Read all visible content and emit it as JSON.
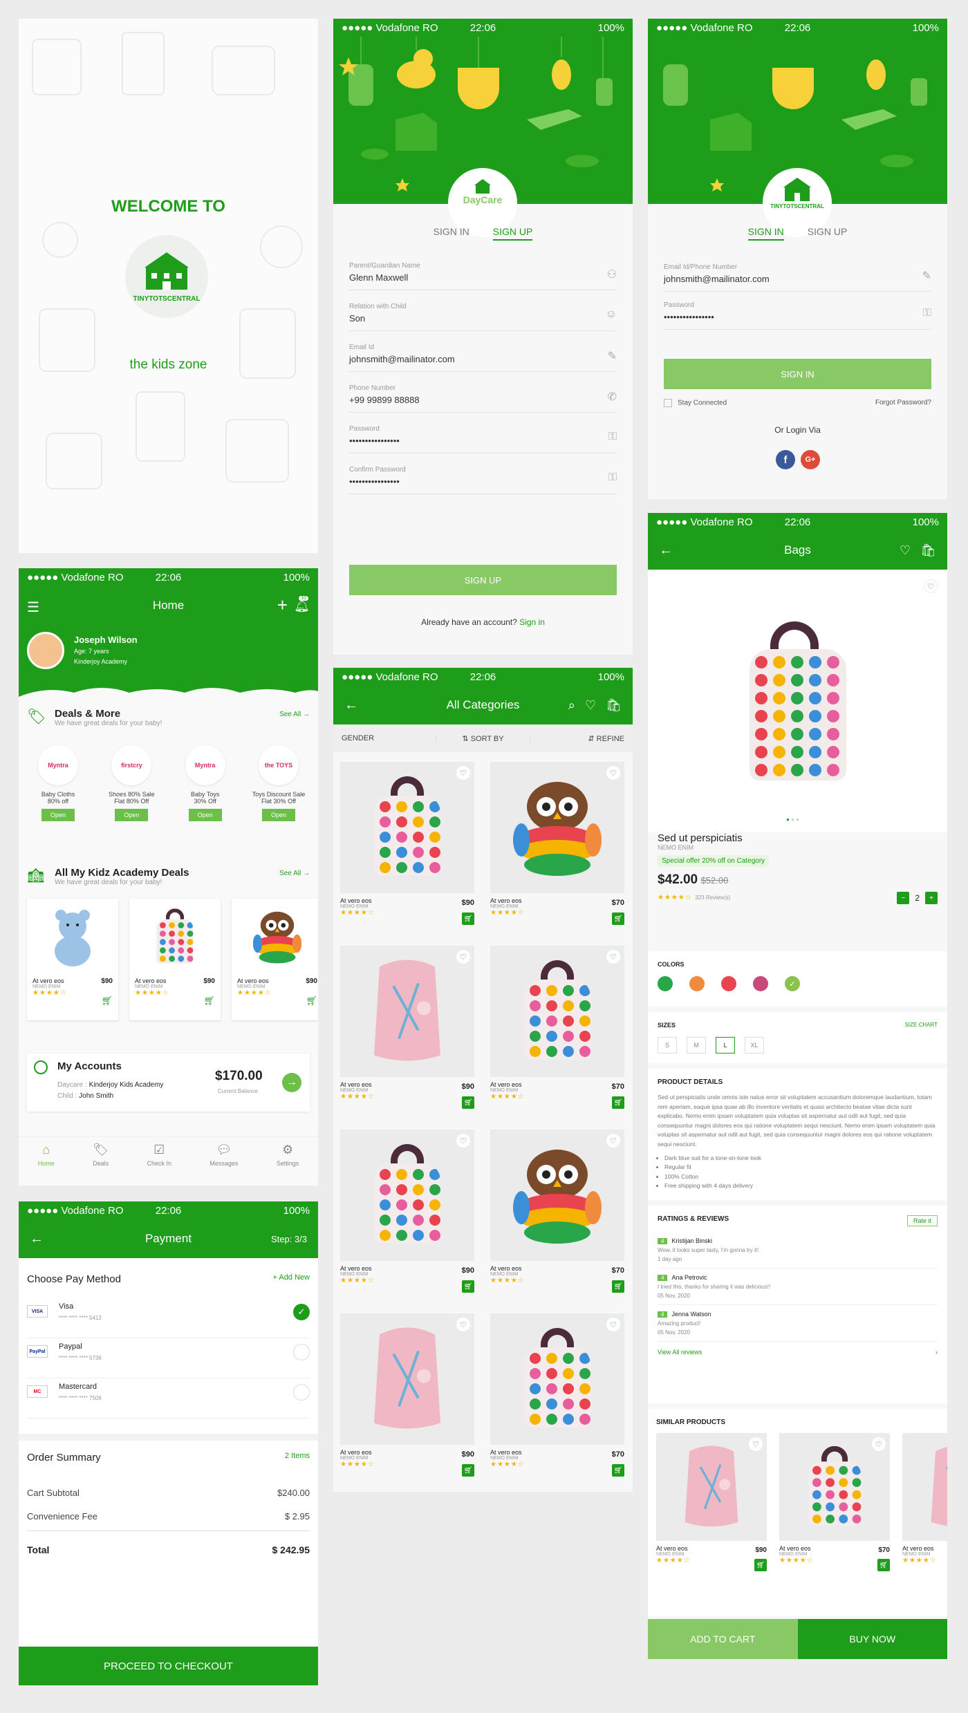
{
  "status": {
    "carrier": "●●●●● Vodafone RO",
    "time": "22:06",
    "battery": "100%"
  },
  "welcome": {
    "title": "WELCOME TO",
    "brand": "TINYTOTSCENTRAL",
    "tagline": "the kids zone"
  },
  "signup": {
    "logo": "DayCare",
    "tab_in": "SIGN IN",
    "tab_up": "SIGN UP",
    "fields": [
      {
        "label": "Parent/Guardian Name",
        "value": "Glenn Maxwell",
        "icon": "user-icon"
      },
      {
        "label": "Relation with Child",
        "value": "Son",
        "icon": "face-icon"
      },
      {
        "label": "Email Id",
        "value": "johnsmith@mailinator.com",
        "icon": "pen-icon"
      },
      {
        "label": "Phone Number",
        "value": "+99 99899 88888",
        "icon": "phone-icon"
      },
      {
        "label": "Password",
        "value": "••••••••••••••••",
        "icon": "key-icon"
      },
      {
        "label": "Confirm Password",
        "value": "••••••••••••••••",
        "icon": "key-icon"
      }
    ],
    "button": "SIGN UP",
    "footer": "Already have an account?",
    "footer_link": "Sign in"
  },
  "signin": {
    "brand": "TINYTOTSCENTRAL",
    "tab_in": "SIGN IN",
    "tab_up": "SIGN UP",
    "email_label": "Email Id/Phone Number",
    "email": "johnsmith@mailinator.com",
    "pass_label": "Password",
    "pass": "••••••••••••••••",
    "button": "SIGN IN",
    "stay": "Stay Connected",
    "forgot": "Forgot Password?",
    "or": "Or Login Via",
    "fb": "f",
    "gp": "G+"
  },
  "home": {
    "title": "Home",
    "badge": "10",
    "user": {
      "name": "Joseph Wilson",
      "age": "Age: 7 years",
      "school": "Kinderjoy Academy"
    },
    "deals": {
      "title": "Deals & More",
      "sub": "We have great deals for your baby!",
      "see": "See All →",
      "items": [
        {
          "brand": "Myntra",
          "l1": "Baby Cloths",
          "l2": "80% off",
          "btn": "Open"
        },
        {
          "brand": "firstcry",
          "l1": "Shoes 80% Sale",
          "l2": "Flat 80% Off",
          "btn": "Open"
        },
        {
          "brand": "Myntra",
          "l1": "Baby Toys",
          "l2": "30% Off",
          "btn": "Open"
        },
        {
          "brand": "the TOYS",
          "l1": "Toys Discount Sale",
          "l2": "Flat 30% Off",
          "btn": "Open"
        }
      ]
    },
    "kidz": {
      "title": "All My Kidz Academy Deals",
      "sub": "We have great deals for your baby!",
      "see": "See All →",
      "items": [
        {
          "name": "At vero eos",
          "brand": "NEMO ENIM",
          "price": "$90"
        },
        {
          "name": "At vero eos",
          "brand": "NEMO ENIM",
          "price": "$90"
        },
        {
          "name": "At vero eos",
          "brand": "NEMO ENIM",
          "price": "$90"
        }
      ]
    },
    "account": {
      "title": "My Accounts",
      "daycare_l": "Daycare :",
      "daycare": "Kinderjoy Kids Academy",
      "child_l": "Child :",
      "child": "John Smith",
      "balance": "$170.00",
      "balance_l": "Current Balance"
    },
    "nav": [
      "Home",
      "Deals",
      "Check In",
      "Messages",
      "Settings"
    ]
  },
  "categories": {
    "title": "All Categories",
    "badge": "10",
    "filters": [
      "GENDER",
      "SORT BY",
      "REFINE"
    ],
    "items": [
      {
        "name": "At vero eos",
        "brand": "NEMO ENIM",
        "price": "$90",
        "kind": "bag"
      },
      {
        "name": "At vero eos",
        "brand": "NEMO ENIM",
        "price": "$70",
        "kind": "owl"
      },
      {
        "name": "At vero eos",
        "brand": "NEMO ENIM",
        "price": "$90",
        "kind": "pink"
      },
      {
        "name": "At vero eos",
        "brand": "NEMO ENIM",
        "price": "$70",
        "kind": "bag"
      },
      {
        "name": "At vero eos",
        "brand": "NEMO ENIM",
        "price": "$90",
        "kind": "bag"
      },
      {
        "name": "At vero eos",
        "brand": "NEMO ENIM",
        "price": "$70",
        "kind": "owl"
      },
      {
        "name": "At vero eos",
        "brand": "NEMO ENIM",
        "price": "$90",
        "kind": "pink"
      },
      {
        "name": "At vero eos",
        "brand": "NEMO ENIM",
        "price": "$70",
        "kind": "bag"
      }
    ]
  },
  "payment": {
    "title": "Payment",
    "step": "Step: 3/3",
    "choose": "Choose Pay Method",
    "add": "+ Add New",
    "methods": [
      {
        "name": "Visa",
        "logo": "VISA",
        "num": "**** **** **** 5412"
      },
      {
        "name": "Paypal",
        "logo": "PayPal",
        "num": "**** **** **** 5736"
      },
      {
        "name": "Mastercard",
        "logo": "MC",
        "num": "**** **** **** 7506"
      }
    ],
    "summary": "Order Summary",
    "items": "2 Items",
    "subtotal_l": "Cart Subtotal",
    "subtotal": "$240.00",
    "fee_l": "Convenience Fee",
    "fee": "$ 2.95",
    "total_l": "Total",
    "total": "$ 242.95",
    "checkout": "PROCEED TO CHECKOUT"
  },
  "product": {
    "title": "Bags",
    "badge": "10",
    "name": "Sed ut perspiciatis",
    "brand": "NEMO ENIM",
    "offer": "Special offer 20% off on Category",
    "price": "$42.00",
    "old": "$52.00",
    "reviews": "323 Review(s)",
    "qty": "2",
    "colors_l": "COLORS",
    "colors": [
      "#2aa64a",
      "#f08a3c",
      "#e9434f",
      "#c84a7a",
      "#8bc34a"
    ],
    "sizes_l": "SIZES",
    "size_chart": "SIZE CHART",
    "sizes": [
      "S",
      "M",
      "L",
      "XL"
    ],
    "details_l": "PRODUCT DETAILS",
    "details": "Sed ut perspiciatis unde omnis iste natus error sit voluptatem accusantium doloremque laudantium, totam rem aperiam, eaque ipsa quae ab illo inventore veritatis et quasi architecto beatae vitae dicta sunt explicabo. Nemo enim ipsam voluptatem quia voluptas sit aspernatur aut odit aut fugit, sed quia consequuntur magni dolores eos qui ratione voluptatem sequi nesciunt. Nemo enim ipsam voluptatem quia voluptas sit aspernatur aut odit aut fugit, sed quia consequuntur magni dolores eos qui ratione voluptatem sequi nesciunt.",
    "bullets": [
      "Dark blue suit for a tone-on-tone look",
      "Regular fit",
      "100% Cotton",
      "Free shipping with 4 days delivery"
    ],
    "ratings_l": "RATINGS & REVIEWS",
    "rate": "Rate it",
    "reviews_list": [
      {
        "score": "4",
        "name": "Kristijan Binski",
        "text": "Wow, it looks super tasty, I'm gonna try it!",
        "date": "1 day ago"
      },
      {
        "score": "4",
        "name": "Ana Petrovic",
        "text": "I tried this, thanks for sharing it was delicious!!",
        "date": "05 Nov, 2020"
      },
      {
        "score": "4",
        "name": "Jenna Watson",
        "text": "Amazing product!",
        "date": "05 Nov, 2020"
      }
    ],
    "view_all": "View All reviews",
    "similar_l": "SIMILAR PRODUCTS",
    "similar": [
      {
        "name": "At vero eos",
        "brand": "NEMO ENIM",
        "price": "$90"
      },
      {
        "name": "At vero eos",
        "brand": "NEMO ENIM",
        "price": "$70"
      },
      {
        "name": "At vero eos",
        "brand": "NEMO ENIM",
        "price": ""
      }
    ],
    "add": "ADD TO CART",
    "buy": "BUY NOW"
  }
}
